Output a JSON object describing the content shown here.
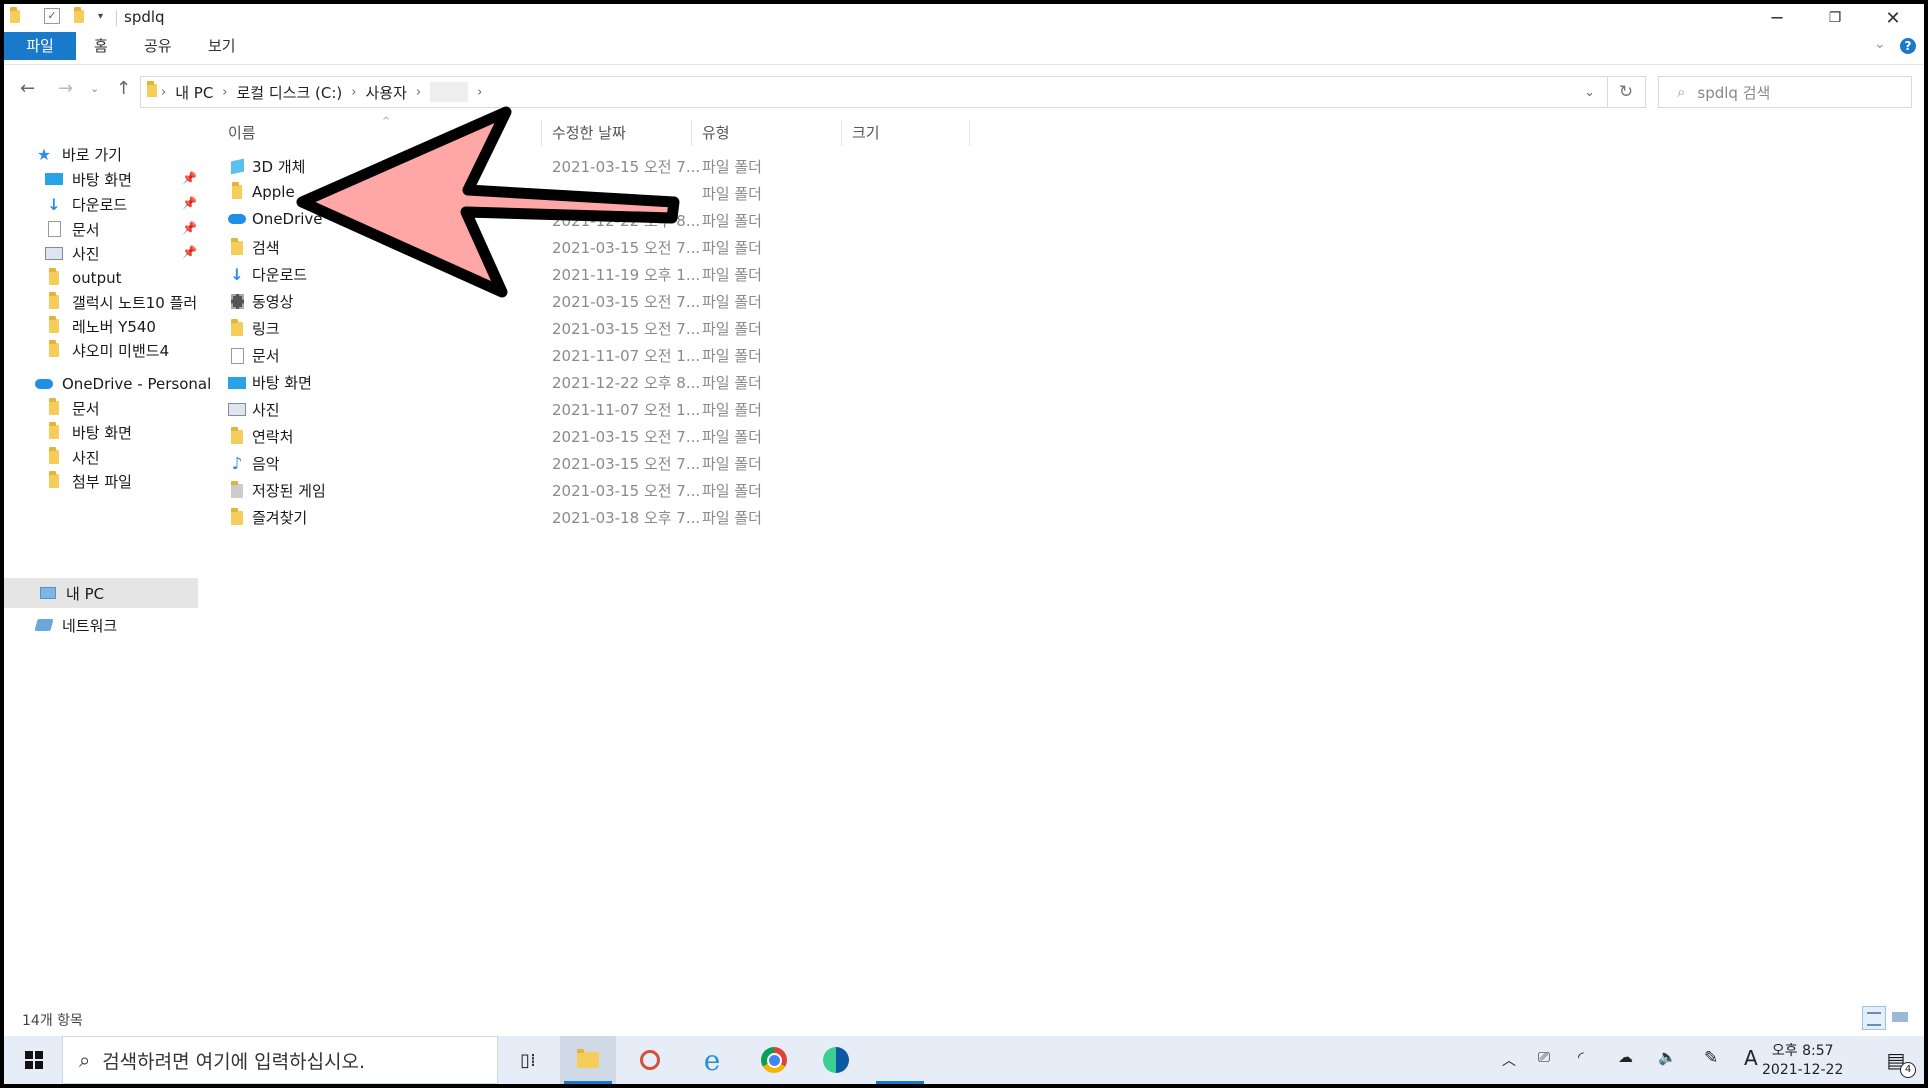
{
  "window": {
    "title": "spdlq",
    "controls": {
      "minimize": "─",
      "restore": "❐",
      "close": "✕"
    }
  },
  "ribbon": {
    "tabs": [
      "파일",
      "홈",
      "공유",
      "보기"
    ],
    "help": "?"
  },
  "address": {
    "crumbs": [
      "내 PC",
      "로컬 디스크 (C:)",
      "사용자",
      ""
    ],
    "search_placeholder": "spdlq 검색"
  },
  "sidebar": {
    "quick_access": "바로 가기",
    "quick_items": [
      {
        "label": "바탕 화면",
        "icon": "desktop-icon",
        "pinned": true
      },
      {
        "label": "다운로드",
        "icon": "download-icon",
        "pinned": true
      },
      {
        "label": "문서",
        "icon": "document-icon",
        "pinned": true
      },
      {
        "label": "사진",
        "icon": "picture-icon",
        "pinned": true
      },
      {
        "label": "output",
        "icon": "folder-icon",
        "pinned": false
      },
      {
        "label": "갤럭시 노트10 플러",
        "icon": "folder-icon",
        "pinned": false
      },
      {
        "label": "레노버 Y540",
        "icon": "folder-icon",
        "pinned": false
      },
      {
        "label": "샤오미 미밴드4",
        "icon": "folder-icon",
        "pinned": false
      }
    ],
    "onedrive": "OneDrive - Personal",
    "onedrive_items": [
      "문서",
      "바탕 화면",
      "사진",
      "첨부 파일"
    ],
    "this_pc": "내 PC",
    "network": "네트워크"
  },
  "columns": {
    "name": "이름",
    "date": "수정한 날짜",
    "type": "유형",
    "size": "크기"
  },
  "files": [
    {
      "name": "3D 개체",
      "date": "2021-03-15 오전 7...",
      "type": "파일 폴더",
      "icon": "3d-objects-icon"
    },
    {
      "name": "Apple",
      "date": "",
      "type": "파일 폴더",
      "icon": "folder-icon"
    },
    {
      "name": "OneDrive",
      "date": "2021-12-22 오후 8...",
      "type": "파일 폴더",
      "icon": "onedrive-icon"
    },
    {
      "name": "검색",
      "date": "2021-03-15 오전 7...",
      "type": "파일 폴더",
      "icon": "search-folder-icon"
    },
    {
      "name": "다운로드",
      "date": "2021-11-19 오후 1...",
      "type": "파일 폴더",
      "icon": "download-icon"
    },
    {
      "name": "동영상",
      "date": "2021-03-15 오전 7...",
      "type": "파일 폴더",
      "icon": "video-icon"
    },
    {
      "name": "링크",
      "date": "2021-03-15 오전 7...",
      "type": "파일 폴더",
      "icon": "links-icon"
    },
    {
      "name": "문서",
      "date": "2021-11-07 오전 1...",
      "type": "파일 폴더",
      "icon": "document-icon"
    },
    {
      "name": "바탕 화면",
      "date": "2021-12-22 오후 8...",
      "type": "파일 폴더",
      "icon": "desktop-icon"
    },
    {
      "name": "사진",
      "date": "2021-11-07 오전 1...",
      "type": "파일 폴더",
      "icon": "picture-icon"
    },
    {
      "name": "연락처",
      "date": "2021-03-15 오전 7...",
      "type": "파일 폴더",
      "icon": "contacts-icon"
    },
    {
      "name": "음악",
      "date": "2021-03-15 오전 7...",
      "type": "파일 폴더",
      "icon": "music-icon"
    },
    {
      "name": "저장된 게임",
      "date": "2021-03-15 오전 7...",
      "type": "파일 폴더",
      "icon": "saved-games-icon"
    },
    {
      "name": "즐겨찾기",
      "date": "2021-03-18 오후 7...",
      "type": "파일 폴더",
      "icon": "favorites-icon"
    }
  ],
  "status": {
    "item_count": "14개 항목"
  },
  "taskbar": {
    "search_placeholder": "검색하려면 여기에 입력하십시오.",
    "ime": "A",
    "time": "오후 8:57",
    "date": "2021-12-22",
    "notifications": "4"
  },
  "colors": {
    "accent": "#1979ca",
    "annotation_arrow": "#ffa6a6"
  }
}
